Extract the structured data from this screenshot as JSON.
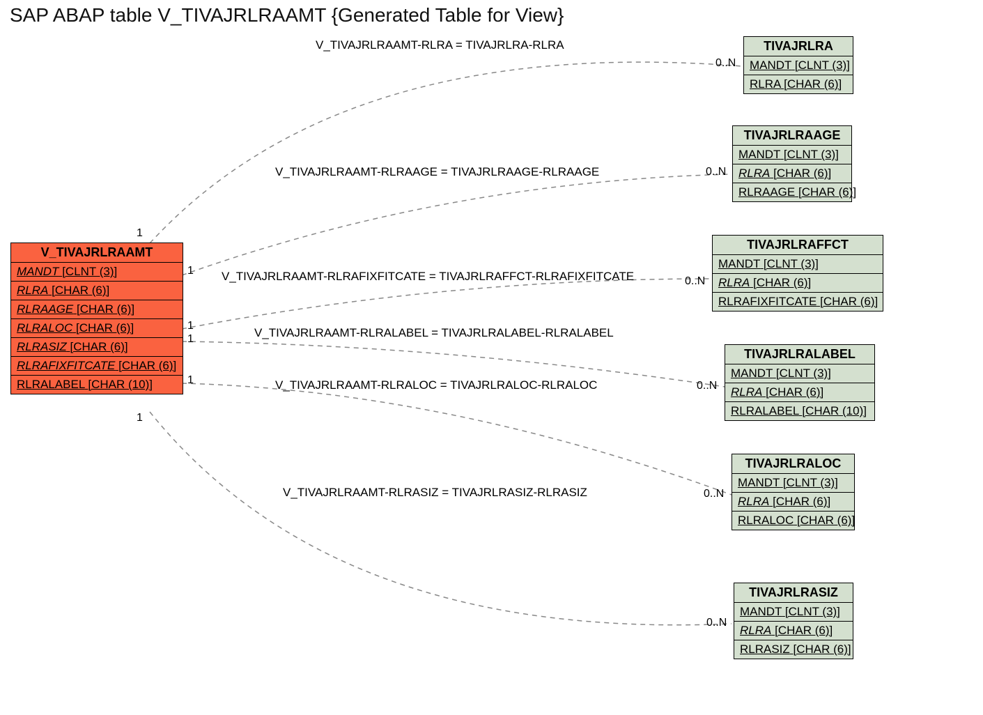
{
  "title": "SAP ABAP table V_TIVAJRLRAAMT {Generated Table for View}",
  "main_entity": {
    "name": "V_TIVAJRLRAAMT",
    "fields": [
      {
        "name": "MANDT",
        "type": "[CLNT (3)]",
        "italic": false
      },
      {
        "name": "RLRA",
        "type": "[CHAR (6)]",
        "italic": true
      },
      {
        "name": "RLRAAGE",
        "type": "[CHAR (6)]",
        "italic": true
      },
      {
        "name": "RLRALOC",
        "type": "[CHAR (6)]",
        "italic": true
      },
      {
        "name": "RLRASIZ",
        "type": "[CHAR (6)]",
        "italic": true
      },
      {
        "name": "RLRAFIXFITCATE",
        "type": "[CHAR (6)]",
        "italic": true
      },
      {
        "name": "RLRALABEL",
        "type": "[CHAR (10)]",
        "italic": false
      }
    ]
  },
  "related_entities": [
    {
      "name": "TIVAJRLRA",
      "fields": [
        {
          "name": "MANDT",
          "type": "[CLNT (3)]",
          "italic": false
        },
        {
          "name": "RLRA",
          "type": "[CHAR (6)]",
          "italic": false
        }
      ]
    },
    {
      "name": "TIVAJRLRAAGE",
      "fields": [
        {
          "name": "MANDT",
          "type": "[CLNT (3)]",
          "italic": false
        },
        {
          "name": "RLRA",
          "type": "[CHAR (6)]",
          "italic": true
        },
        {
          "name": "RLRAAGE",
          "type": "[CHAR (6)]",
          "italic": false
        }
      ]
    },
    {
      "name": "TIVAJRLRAFFCT",
      "fields": [
        {
          "name": "MANDT",
          "type": "[CLNT (3)]",
          "italic": false
        },
        {
          "name": "RLRA",
          "type": "[CHAR (6)]",
          "italic": true
        },
        {
          "name": "RLRAFIXFITCATE",
          "type": "[CHAR (6)]",
          "italic": false
        }
      ]
    },
    {
      "name": "TIVAJRLRALABEL",
      "fields": [
        {
          "name": "MANDT",
          "type": "[CLNT (3)]",
          "italic": false
        },
        {
          "name": "RLRA",
          "type": "[CHAR (6)]",
          "italic": true
        },
        {
          "name": "RLRALABEL",
          "type": "[CHAR (10)]",
          "italic": false
        }
      ]
    },
    {
      "name": "TIVAJRLRALOC",
      "fields": [
        {
          "name": "MANDT",
          "type": "[CLNT (3)]",
          "italic": false
        },
        {
          "name": "RLRA",
          "type": "[CHAR (6)]",
          "italic": true
        },
        {
          "name": "RLRALOC",
          "type": "[CHAR (6)]",
          "italic": false
        }
      ]
    },
    {
      "name": "TIVAJRLRASIZ",
      "fields": [
        {
          "name": "MANDT",
          "type": "[CLNT (3)]",
          "italic": false
        },
        {
          "name": "RLRA",
          "type": "[CHAR (6)]",
          "italic": true
        },
        {
          "name": "RLRASIZ",
          "type": "[CHAR (6)]",
          "italic": false
        }
      ]
    }
  ],
  "edges": [
    {
      "label": "V_TIVAJRLRAAMT-RLRA = TIVAJRLRA-RLRA",
      "left_card": "1",
      "right_card": "0..N"
    },
    {
      "label": "V_TIVAJRLRAAMT-RLRAAGE = TIVAJRLRAAGE-RLRAAGE",
      "left_card": "1",
      "right_card": "0..N"
    },
    {
      "label": "V_TIVAJRLRAAMT-RLRAFIXFITCATE = TIVAJRLRAFFCT-RLRAFIXFITCATE",
      "left_card": "1",
      "right_card": "0..N"
    },
    {
      "label": "V_TIVAJRLRAAMT-RLRALABEL = TIVAJRLRALABEL-RLRALABEL",
      "left_card": "1",
      "right_card": "0..N"
    },
    {
      "label": "V_TIVAJRLRAAMT-RLRALOC = TIVAJRLRALOC-RLRALOC",
      "left_card": "1",
      "right_card": "0..N"
    },
    {
      "label": "V_TIVAJRLRAAMT-RLRASIZ = TIVAJRLRASIZ-RLRASIZ",
      "left_card": "1",
      "right_card": "0..N"
    }
  ]
}
